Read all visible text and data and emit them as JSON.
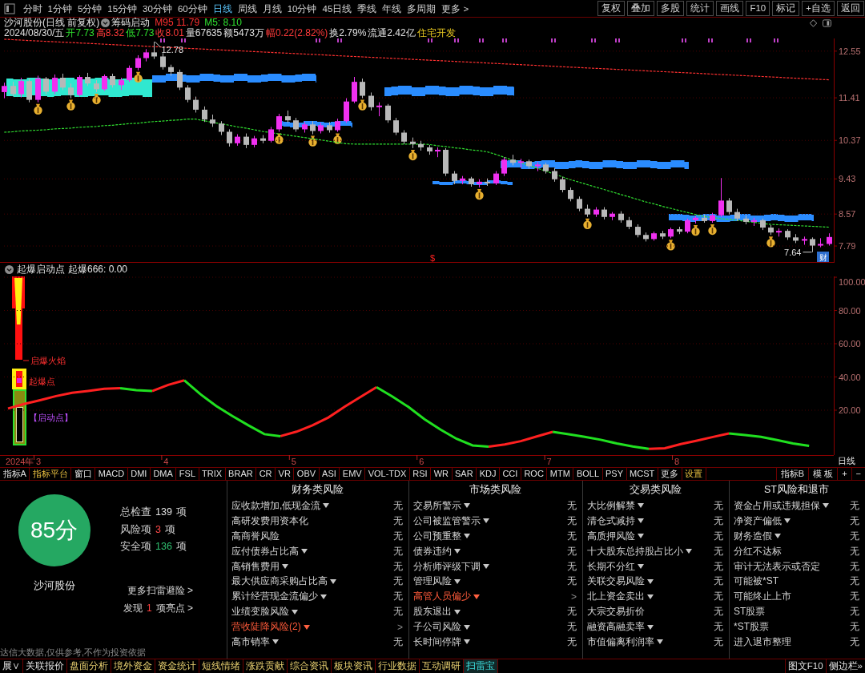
{
  "toolbar": {
    "periods": [
      {
        "label": "分时",
        "selected": false
      },
      {
        "label": "1分钟",
        "selected": false
      },
      {
        "label": "5分钟",
        "selected": false
      },
      {
        "label": "15分钟",
        "selected": false
      },
      {
        "label": "30分钟",
        "selected": false
      },
      {
        "label": "60分钟",
        "selected": false
      },
      {
        "label": "日线",
        "selected": true
      },
      {
        "label": "周线",
        "selected": false
      },
      {
        "label": "月线",
        "selected": false
      },
      {
        "label": "10分钟",
        "selected": false
      },
      {
        "label": "45日线",
        "selected": false
      },
      {
        "label": "季线",
        "selected": false
      },
      {
        "label": "年线",
        "selected": false
      },
      {
        "label": "多周期",
        "selected": false
      },
      {
        "label": "更多 >",
        "selected": false
      }
    ],
    "actions": [
      "复权",
      "叠加",
      "多股",
      "统计",
      "画线",
      "F10",
      "标记",
      "+自选",
      "返回"
    ]
  },
  "price_chart": {
    "title": "沙河股份(日线 前复权)",
    "indicator": "筹码启动",
    "averages": [
      {
        "label": "M95",
        "value": "11.79"
      },
      {
        "label": "M5:",
        "value": "8.10"
      }
    ],
    "date": "2024/08/30/五",
    "quote": [
      {
        "label": "开",
        "value": "7.73",
        "color": "#2ee02e"
      },
      {
        "label": "高",
        "value": "8.32",
        "color": "#ff3a3a"
      },
      {
        "label": "低",
        "value": "7.73",
        "color": "#2ee02e"
      },
      {
        "label": "收",
        "value": "8.01",
        "color": "#ff3a3a"
      },
      {
        "label": "量",
        "value": "67635",
        "color": "#e0e0e0"
      },
      {
        "label": "额",
        "value": "5473万",
        "color": "#e0e0e0"
      },
      {
        "label": "幅",
        "value": "0.22(2.82%)",
        "color": "#ff3a3a"
      },
      {
        "label": "换",
        "value": "2.79%",
        "color": "#e0e0e0"
      },
      {
        "label": "流通",
        "value": "2.42亿",
        "color": "#e0e0e0"
      }
    ],
    "sector": "住宅开发",
    "high_label": "12.78",
    "low_label": "7.64",
    "signal_mark": "$",
    "badge": "财",
    "chart_data": {
      "type": "candlestick",
      "grid": true,
      "ylim": [
        7.38,
        12.86
      ],
      "yticks": [
        {
          "value": 12.55,
          "label": "12.55"
        },
        {
          "value": 11.41,
          "label": "11.41"
        },
        {
          "value": 10.37,
          "label": "10.37"
        },
        {
          "value": 9.43,
          "label": "9.43"
        },
        {
          "value": 8.57,
          "label": "8.57"
        },
        {
          "value": 7.79,
          "label": "7.79"
        }
      ],
      "categories": [
        null,
        null,
        null,
        null,
        null,
        null,
        null,
        null,
        null,
        null,
        null,
        null,
        null,
        null,
        null,
        null,
        null,
        null,
        null,
        null,
        null,
        null,
        null,
        null,
        null,
        null,
        null,
        null,
        null,
        null,
        null,
        null,
        null,
        null,
        null,
        null,
        null,
        null,
        null,
        null,
        null,
        null,
        null,
        null,
        null,
        null,
        null,
        null,
        null,
        null,
        null,
        null,
        null,
        null,
        null,
        null,
        null,
        null,
        null,
        null,
        null,
        null,
        null,
        null,
        null,
        null,
        null,
        null,
        null,
        null,
        null,
        null,
        null,
        null,
        null,
        null,
        null,
        null,
        null,
        null,
        null,
        null,
        null,
        null,
        null,
        null,
        null,
        null,
        null,
        null,
        null,
        null,
        null,
        null,
        null,
        null,
        null,
        null,
        null,
        null
      ],
      "ohlc": [
        [
          11.55,
          11.78,
          11.4,
          11.7
        ],
        [
          11.7,
          11.8,
          11.45,
          11.5
        ],
        [
          11.5,
          11.9,
          11.42,
          11.82
        ],
        [
          11.82,
          11.88,
          11.3,
          11.36
        ],
        [
          11.36,
          11.95,
          11.3,
          11.88
        ],
        [
          11.88,
          11.92,
          11.5,
          11.56
        ],
        [
          11.56,
          11.98,
          11.5,
          11.9
        ],
        [
          11.9,
          12.0,
          11.6,
          11.66
        ],
        [
          11.66,
          11.76,
          11.4,
          11.48
        ],
        [
          11.48,
          11.96,
          11.44,
          11.92
        ],
        [
          11.92,
          12.02,
          11.7,
          11.76
        ],
        [
          11.76,
          11.84,
          11.55,
          11.62
        ],
        [
          11.62,
          11.98,
          11.58,
          11.94
        ],
        [
          11.94,
          12.0,
          11.66,
          11.72
        ],
        [
          11.72,
          11.9,
          11.6,
          11.84
        ],
        [
          11.84,
          12.2,
          11.8,
          12.14
        ],
        [
          12.14,
          12.45,
          12.08,
          12.38
        ],
        [
          12.38,
          12.6,
          12.3,
          12.52
        ],
        [
          12.52,
          12.78,
          12.36,
          12.42
        ],
        [
          12.42,
          12.5,
          12.1,
          12.16
        ],
        [
          12.16,
          12.22,
          11.95,
          12.04
        ],
        [
          12.04,
          12.1,
          11.6,
          11.66
        ],
        [
          11.66,
          11.72,
          11.3,
          11.36
        ],
        [
          11.36,
          11.44,
          11.05,
          11.12
        ],
        [
          11.12,
          11.2,
          10.82,
          10.88
        ],
        [
          10.88,
          11.0,
          10.7,
          10.78
        ],
        [
          10.78,
          10.84,
          10.5,
          10.58
        ],
        [
          10.58,
          10.64,
          10.22,
          10.3
        ],
        [
          10.3,
          10.52,
          10.24,
          10.46
        ],
        [
          10.46,
          10.54,
          10.18,
          10.26
        ],
        [
          10.26,
          10.48,
          10.2,
          10.42
        ],
        [
          10.42,
          10.5,
          10.3,
          10.36
        ],
        [
          10.36,
          10.7,
          10.32,
          10.64
        ],
        [
          10.64,
          11.02,
          10.58,
          10.96
        ],
        [
          10.96,
          11.1,
          10.8,
          10.86
        ],
        [
          10.86,
          10.92,
          10.58,
          10.64
        ],
        [
          10.64,
          10.82,
          10.56,
          10.76
        ],
        [
          10.76,
          10.84,
          10.52,
          10.6
        ],
        [
          10.6,
          10.8,
          10.54,
          10.74
        ],
        [
          10.74,
          10.82,
          10.56,
          10.62
        ],
        [
          10.62,
          10.9,
          10.58,
          10.84
        ],
        [
          10.84,
          11.4,
          10.8,
          11.32
        ],
        [
          11.32,
          11.92,
          11.28,
          11.8
        ],
        [
          11.8,
          11.88,
          11.4,
          11.46
        ],
        [
          11.46,
          11.54,
          11.1,
          11.18
        ],
        [
          11.18,
          11.3,
          10.96,
          11.22
        ],
        [
          11.22,
          11.26,
          10.8,
          10.86
        ],
        [
          10.86,
          10.92,
          10.5,
          10.56
        ],
        [
          10.56,
          10.62,
          10.28,
          10.34
        ],
        [
          10.34,
          10.44,
          10.18,
          10.28
        ],
        [
          10.28,
          10.36,
          10.12,
          10.2
        ],
        [
          10.2,
          10.26,
          10.02,
          10.1
        ],
        [
          10.1,
          10.2,
          9.96,
          10.14
        ],
        [
          10.14,
          10.18,
          9.5,
          9.56
        ],
        [
          9.56,
          9.62,
          9.3,
          9.38
        ],
        [
          9.38,
          9.5,
          9.3,
          9.44
        ],
        [
          9.44,
          9.48,
          9.24,
          9.3
        ],
        [
          9.3,
          9.42,
          9.22,
          9.36
        ],
        [
          9.36,
          9.44,
          9.26,
          9.32
        ],
        [
          9.32,
          9.62,
          9.28,
          9.56
        ],
        [
          9.56,
          9.96,
          9.5,
          9.9
        ],
        [
          9.9,
          10.02,
          9.76,
          9.82
        ],
        [
          9.82,
          9.92,
          9.7,
          9.86
        ],
        [
          9.86,
          9.9,
          9.68,
          9.74
        ],
        [
          9.74,
          9.84,
          9.62,
          9.78
        ],
        [
          9.78,
          9.82,
          9.56,
          9.62
        ],
        [
          9.62,
          9.7,
          9.36,
          9.42
        ],
        [
          9.42,
          9.48,
          9.1,
          9.16
        ],
        [
          9.16,
          9.22,
          8.88,
          8.94
        ],
        [
          8.94,
          9.0,
          8.64,
          8.7
        ],
        [
          8.7,
          8.8,
          8.5,
          8.56
        ],
        [
          8.56,
          8.74,
          8.5,
          8.68
        ],
        [
          8.68,
          8.74,
          8.44,
          8.5
        ],
        [
          8.5,
          8.62,
          8.42,
          8.58
        ],
        [
          8.58,
          8.64,
          8.36,
          8.42
        ],
        [
          8.42,
          8.5,
          8.2,
          8.26
        ],
        [
          8.26,
          8.32,
          8.0,
          8.06
        ],
        [
          8.06,
          8.12,
          7.9,
          7.96
        ],
        [
          7.96,
          8.14,
          7.92,
          8.1
        ],
        [
          8.1,
          8.16,
          7.96,
          8.02
        ],
        [
          8.02,
          8.24,
          7.98,
          8.2
        ],
        [
          8.2,
          8.26,
          8.08,
          8.14
        ],
        [
          8.14,
          8.46,
          8.1,
          8.42
        ],
        [
          8.42,
          8.52,
          8.34,
          8.48
        ],
        [
          8.48,
          8.56,
          8.36,
          8.4
        ],
        [
          8.4,
          8.6,
          8.36,
          8.54
        ],
        [
          8.54,
          9.45,
          8.5,
          8.9
        ],
        [
          8.9,
          8.96,
          8.56,
          8.62
        ],
        [
          8.62,
          8.7,
          8.4,
          8.46
        ],
        [
          8.46,
          8.54,
          8.32,
          8.38
        ],
        [
          8.38,
          8.48,
          8.28,
          8.42
        ],
        [
          8.42,
          8.46,
          8.18,
          8.24
        ],
        [
          8.24,
          8.3,
          8.06,
          8.12
        ],
        [
          8.12,
          8.22,
          8.02,
          8.16
        ],
        [
          8.16,
          8.2,
          7.94,
          8.0
        ],
        [
          8.0,
          8.08,
          7.86,
          7.92
        ],
        [
          7.92,
          8.02,
          7.82,
          7.96
        ],
        [
          7.96,
          8.0,
          7.64,
          7.8
        ],
        [
          7.8,
          7.98,
          7.76,
          7.84
        ],
        [
          7.84,
          8.1,
          7.8,
          8.01
        ]
      ],
      "series": [
        {
          "type": "line",
          "color": "#ff3030",
          "line_style": "dotted",
          "values": [
            12.84,
            12.83,
            12.82,
            12.81,
            12.8,
            12.79,
            12.78,
            12.77,
            12.76,
            12.75,
            12.74,
            12.73,
            12.72,
            12.71,
            12.7,
            12.69,
            12.68,
            12.67,
            12.66,
            12.65,
            12.64,
            12.63,
            12.62,
            12.61,
            12.6,
            12.59,
            12.58,
            12.57,
            12.56,
            12.55,
            12.54,
            12.53,
            12.52,
            12.51,
            12.5,
            12.49,
            12.48,
            12.47,
            12.46,
            12.45,
            12.44,
            12.43,
            12.42,
            12.41,
            12.4,
            12.39,
            12.38,
            12.37,
            12.36,
            12.35,
            12.34,
            12.33,
            12.32,
            12.31,
            12.3,
            12.29,
            12.28,
            12.27,
            12.26,
            12.25,
            12.24,
            12.23,
            12.22,
            12.21,
            12.2,
            12.19,
            12.18,
            12.17,
            12.16,
            12.15,
            12.14,
            12.13,
            12.12,
            12.11,
            12.1,
            12.09,
            12.08,
            12.07,
            12.06,
            12.05,
            12.04,
            12.03,
            12.02,
            12.01,
            12.0,
            11.99,
            11.98,
            11.97,
            11.96,
            11.95,
            11.94,
            11.93,
            11.92,
            11.91,
            11.9,
            11.89,
            11.88,
            11.87,
            11.86,
            11.85
          ]
        },
        {
          "type": "line",
          "color": "#30e030",
          "line_style": "dotted",
          "values": [
            10.57,
            10.58,
            10.6,
            10.61,
            10.62,
            10.63,
            10.65,
            10.66,
            10.67,
            10.69,
            10.7,
            10.71,
            10.73,
            10.74,
            10.76,
            10.78,
            10.79,
            10.81,
            10.83,
            10.84,
            10.86,
            10.87,
            10.89,
            10.89,
            10.85,
            10.81,
            10.78,
            10.74,
            10.7,
            10.67,
            10.63,
            10.59,
            10.56,
            10.53,
            10.5,
            10.47,
            10.44,
            10.41,
            10.38,
            10.35,
            10.32,
            10.29,
            10.28,
            10.28,
            10.28,
            10.28,
            10.28,
            10.28,
            10.28,
            10.28,
            10.28,
            10.27,
            10.24,
            10.22,
            10.19,
            10.17,
            10.14,
            10.12,
            10.09,
            10.03,
            9.96,
            9.89,
            9.83,
            9.76,
            9.69,
            9.62,
            9.55,
            9.48,
            9.41,
            9.35,
            9.29,
            9.23,
            9.17,
            9.11,
            9.05,
            8.99,
            8.93,
            8.87,
            8.82,
            8.76,
            8.71,
            8.66,
            8.61,
            8.56,
            8.51,
            8.49,
            8.46,
            8.44,
            8.42,
            8.39,
            8.37,
            8.34,
            8.32,
            8.31,
            8.3,
            8.29,
            8.28,
            8.27,
            8.26,
            8.25
          ]
        }
      ]
    }
  },
  "indicator": {
    "title": "起爆启动点",
    "reading": "起爆666: 0.00",
    "signal_labels": [
      "启爆火焰",
      "起爆点",
      "【启动点】"
    ],
    "chart_data": {
      "type": "line",
      "grid": true,
      "xlim": [
        2.699,
        9.223
      ],
      "ylim": [
        -7,
        100.5
      ],
      "xticks": [
        {
          "value": 3,
          "label": "3"
        },
        {
          "value": 4,
          "label": "4"
        },
        {
          "value": 5,
          "label": "5"
        },
        {
          "value": 6,
          "label": "6"
        },
        {
          "value": 7,
          "label": "7"
        },
        {
          "value": 8,
          "label": "8"
        }
      ],
      "yticks": [
        {
          "value": 100,
          "label": "100.00"
        },
        {
          "value": 80,
          "label": "80.00"
        },
        {
          "value": 60,
          "label": "60.00"
        },
        {
          "value": 40,
          "label": "40.00"
        },
        {
          "value": 20,
          "label": "20.00"
        }
      ],
      "x": [
        2.762,
        2.887,
        3.013,
        3.138,
        3.264,
        3.389,
        3.515,
        3.64,
        3.766,
        3.891,
        4.017,
        4.142,
        4.268,
        4.393,
        4.519,
        4.644,
        4.77,
        4.895,
        5.021,
        5.146,
        5.271,
        5.397,
        5.522,
        5.648,
        5.773,
        5.899,
        6.024,
        6.15,
        6.275,
        6.401,
        6.526,
        6.652,
        6.777,
        6.903,
        7.028,
        7.153,
        7.279,
        7.404,
        7.53,
        7.655,
        7.781,
        7.906,
        8.032,
        8.157,
        8.283,
        8.408,
        8.534,
        8.659,
        8.785,
        8.91,
        9.036
      ],
      "series": [
        {
          "color": "#ff2020",
          "values": [
            21,
            23.7,
            26,
            28.5,
            30.5,
            31.6,
            32.9,
            33.3,
            null,
            31.5,
            35.3,
            38,
            null,
            null,
            null,
            null,
            null,
            4.4,
            7.1,
            10.9,
            15.6,
            22,
            28,
            33.9,
            null,
            null,
            null,
            null,
            null,
            null,
            -1.9,
            -0.6,
            1.4,
            4.2,
            7,
            null,
            null,
            null,
            null,
            null,
            -3.3,
            -2.9,
            -0.4,
            1.7,
            3.9,
            6,
            null,
            null,
            null,
            null,
            null
          ]
        },
        {
          "color": "#20e020",
          "values": [
            null,
            null,
            null,
            null,
            null,
            null,
            null,
            33.3,
            32,
            31.5,
            null,
            38,
            29.7,
            22.5,
            16.5,
            10.9,
            5.6,
            4.4,
            null,
            null,
            null,
            null,
            null,
            33.9,
            28.2,
            21.9,
            14.6,
            8.3,
            2.8,
            -1.2,
            -1.9,
            null,
            null,
            null,
            7,
            5.5,
            4,
            2.2,
            0,
            -1.8,
            -3.3,
            null,
            null,
            null,
            null,
            6,
            5,
            4,
            2,
            0,
            -1.5
          ]
        }
      ]
    }
  },
  "time_axis": {
    "year": "2024年",
    "period_button": "日线"
  },
  "indicator_tabs": {
    "left": [
      {
        "label": "指标A",
        "highlighted": false
      },
      {
        "label": "指标平台",
        "highlighted": true
      },
      {
        "label": "窗口",
        "highlighted": false
      },
      {
        "label": "MACD",
        "highlighted": false
      },
      {
        "label": "DMI",
        "highlighted": false
      },
      {
        "label": "DMA",
        "highlighted": false
      },
      {
        "label": "FSL",
        "highlighted": false
      },
      {
        "label": "TRIX",
        "highlighted": false
      },
      {
        "label": "BRAR",
        "highlighted": false
      },
      {
        "label": "CR",
        "highlighted": false
      },
      {
        "label": "VR",
        "highlighted": false
      },
      {
        "label": "OBV",
        "highlighted": false
      },
      {
        "label": "ASI",
        "highlighted": false
      },
      {
        "label": "EMV",
        "highlighted": false
      },
      {
        "label": "VOL-TDX",
        "highlighted": false
      },
      {
        "label": "RSI",
        "highlighted": false
      },
      {
        "label": "WR",
        "highlighted": false
      },
      {
        "label": "SAR",
        "highlighted": false
      },
      {
        "label": "KDJ",
        "highlighted": false
      },
      {
        "label": "CCI",
        "highlighted": false
      },
      {
        "label": "ROC",
        "highlighted": false
      },
      {
        "label": "MTM",
        "highlighted": false
      },
      {
        "label": "BOLL",
        "highlighted": false
      },
      {
        "label": "PSY",
        "highlighted": false
      },
      {
        "label": "MCST",
        "highlighted": false
      },
      {
        "label": "更多",
        "highlighted": false
      },
      {
        "label": "设置",
        "highlighted": true
      }
    ],
    "right": [
      "指标B",
      "模 板",
      "+",
      "−"
    ]
  },
  "risk_scan": {
    "score": "85分",
    "stock": "沙河股份",
    "stats": [
      {
        "label": "总检查",
        "value": "139",
        "unit": "项",
        "color": "#e0e0e0"
      },
      {
        "label": "风险项",
        "value": "3",
        "unit": "项",
        "color": "#ff4a4a"
      },
      {
        "label": "安全项",
        "value": "136",
        "unit": "项",
        "color": "#2fbf6f"
      }
    ],
    "more_link": "更多扫雷避险 >",
    "highlight_link": {
      "before": "发现",
      "count": "1",
      "after": "项亮点 >"
    },
    "disclaimer": "达信大数据,仅供参考,不作为投资依据",
    "categories": [
      {
        "title": "财务类风险",
        "items": [
          {
            "label": "应收款增加,低现金流",
            "dropdown": true,
            "risk": false,
            "result": "无"
          },
          {
            "label": "高研发费用资本化",
            "dropdown": false,
            "risk": false,
            "result": "无"
          },
          {
            "label": "高商誉风险",
            "dropdown": false,
            "risk": false,
            "result": "无"
          },
          {
            "label": "应付债券占比高",
            "dropdown": true,
            "risk": false,
            "result": "无"
          },
          {
            "label": "高销售费用",
            "dropdown": true,
            "risk": false,
            "result": "无"
          },
          {
            "label": "最大供应商采购占比高",
            "dropdown": true,
            "risk": false,
            "result": "无"
          },
          {
            "label": "累计经营现金流偏少",
            "dropdown": true,
            "risk": false,
            "result": "无"
          },
          {
            "label": "业绩变脸风险",
            "dropdown": true,
            "risk": false,
            "result": "无"
          },
          {
            "label": "营收陡降风险(2)",
            "dropdown": true,
            "risk": true,
            "result": ">"
          },
          {
            "label": "高市销率",
            "dropdown": true,
            "risk": false,
            "result": "无"
          }
        ]
      },
      {
        "title": "市场类风险",
        "items": [
          {
            "label": "交易所警示",
            "dropdown": true,
            "risk": false,
            "result": "无"
          },
          {
            "label": "公司被监管警示",
            "dropdown": true,
            "risk": false,
            "result": "无"
          },
          {
            "label": "公司预重整",
            "dropdown": true,
            "risk": false,
            "result": "无"
          },
          {
            "label": "债券违约",
            "dropdown": true,
            "risk": false,
            "result": "无"
          },
          {
            "label": "分析师评级下调",
            "dropdown": true,
            "risk": false,
            "result": "无"
          },
          {
            "label": "管理风险",
            "dropdown": true,
            "risk": false,
            "result": "无"
          },
          {
            "label": "高管人员偏少",
            "dropdown": true,
            "risk": true,
            "result": ">"
          },
          {
            "label": "股东退出",
            "dropdown": true,
            "risk": false,
            "result": "无"
          },
          {
            "label": "子公司风险",
            "dropdown": true,
            "risk": false,
            "result": "无"
          },
          {
            "label": "长时间停牌",
            "dropdown": true,
            "risk": false,
            "result": "无"
          }
        ]
      },
      {
        "title": "交易类风险",
        "items": [
          {
            "label": "大比例解禁",
            "dropdown": true,
            "risk": false,
            "result": "无"
          },
          {
            "label": "清仓式减持",
            "dropdown": true,
            "risk": false,
            "result": "无"
          },
          {
            "label": "高质押风险",
            "dropdown": true,
            "risk": false,
            "result": "无"
          },
          {
            "label": "十大股东总持股占比小",
            "dropdown": true,
            "risk": false,
            "result": "无"
          },
          {
            "label": "长期不分红",
            "dropdown": true,
            "risk": false,
            "result": "无"
          },
          {
            "label": "关联交易风险",
            "dropdown": true,
            "risk": false,
            "result": "无"
          },
          {
            "label": "北上资金卖出",
            "dropdown": true,
            "risk": false,
            "result": "无"
          },
          {
            "label": "大宗交易折价",
            "dropdown": false,
            "risk": false,
            "result": "无"
          },
          {
            "label": "融资高融卖率",
            "dropdown": true,
            "risk": false,
            "result": "无"
          },
          {
            "label": "市值偏离利润率",
            "dropdown": true,
            "risk": false,
            "result": "无"
          }
        ]
      },
      {
        "title": "ST风险和退市",
        "items": [
          {
            "label": "资金占用或违规担保",
            "dropdown": true,
            "risk": false,
            "result": "无"
          },
          {
            "label": "净资产偏低",
            "dropdown": true,
            "risk": false,
            "result": "无"
          },
          {
            "label": "财务造假",
            "dropdown": true,
            "risk": false,
            "result": "无"
          },
          {
            "label": "分红不达标",
            "dropdown": false,
            "risk": false,
            "result": "无"
          },
          {
            "label": "审计无法表示或否定",
            "dropdown": false,
            "risk": false,
            "result": "无"
          },
          {
            "label": "可能被*ST",
            "dropdown": false,
            "risk": false,
            "result": "无"
          },
          {
            "label": "可能终止上市",
            "dropdown": false,
            "risk": false,
            "result": "无"
          },
          {
            "label": "ST股票",
            "dropdown": false,
            "risk": false,
            "result": "无"
          },
          {
            "label": "*ST股票",
            "dropdown": false,
            "risk": false,
            "result": "无"
          },
          {
            "label": "进入退市整理",
            "dropdown": false,
            "risk": false,
            "result": "无"
          }
        ]
      }
    ]
  },
  "bottom_tabs": {
    "tabs": [
      {
        "label": "展∨",
        "kind": "plain",
        "selected": false
      },
      {
        "label": "关联报价",
        "kind": "plain",
        "selected": false
      },
      {
        "label": "盘面分析",
        "kind": "module",
        "selected": false
      },
      {
        "label": "境外资金",
        "kind": "module",
        "selected": false
      },
      {
        "label": "资金统计",
        "kind": "module",
        "selected": false
      },
      {
        "label": "短线情绪",
        "kind": "module",
        "selected": false
      },
      {
        "label": "涨跌贡献",
        "kind": "module",
        "selected": false
      },
      {
        "label": "综合资讯",
        "kind": "module",
        "selected": false
      },
      {
        "label": "板块资讯",
        "kind": "module",
        "selected": false
      },
      {
        "label": "行业数据",
        "kind": "module",
        "selected": false
      },
      {
        "label": "互动调研",
        "kind": "module",
        "selected": false
      },
      {
        "label": "扫雷宝",
        "kind": "module",
        "selected": true
      }
    ],
    "right": [
      "图文F10",
      "侧边栏»"
    ]
  }
}
